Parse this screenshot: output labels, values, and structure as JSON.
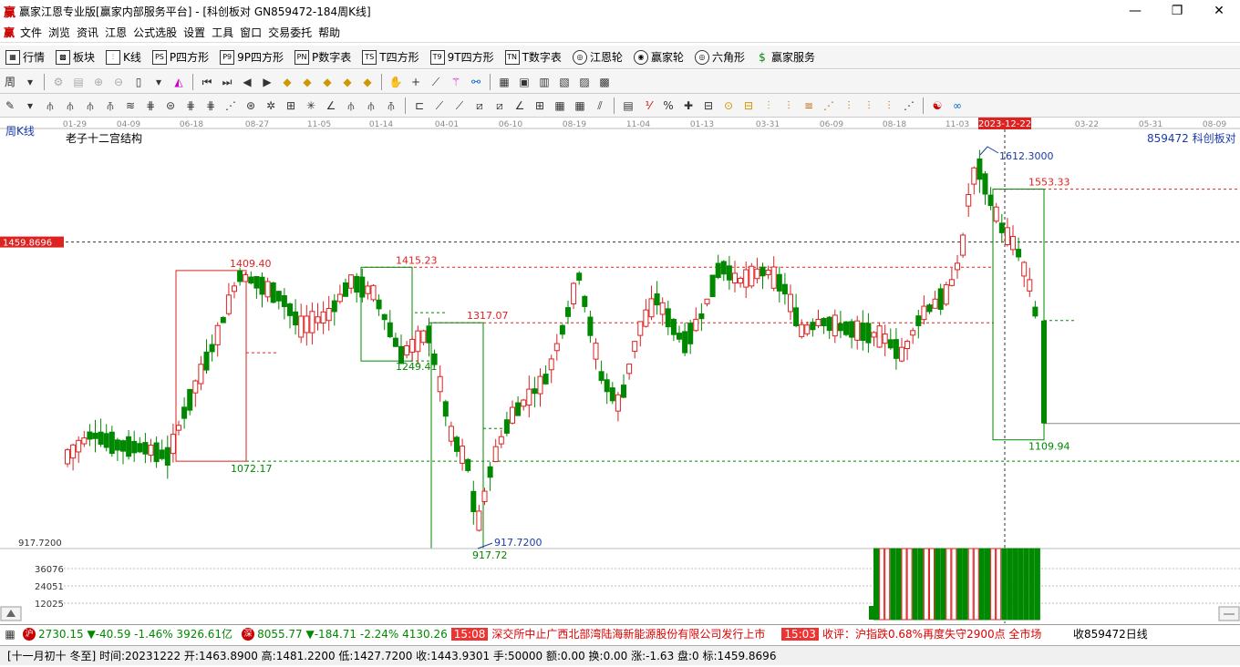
{
  "window": {
    "logo": "赢",
    "title": "赢家江恩专业版[赢家内部服务平台] - [科创板对  GN859472-184周K线]",
    "minimize": "—",
    "maximize": "❐",
    "close": "✕"
  },
  "menu": {
    "logo": "赢",
    "items": [
      "文件",
      "浏览",
      "资讯",
      "江恩",
      "公式选股",
      "设置",
      "工具",
      "窗口",
      "交易委托",
      "帮助"
    ],
    "mdi_min": "_",
    "mdi_restore": "❐",
    "mdi_close": "✕"
  },
  "toolbar1": {
    "items": [
      {
        "icon": "▦",
        "label": "行情"
      },
      {
        "icon": "▩",
        "label": "板块"
      },
      {
        "icon": "⫶",
        "label": "K线"
      },
      {
        "icon": "PS",
        "label": "P四方形"
      },
      {
        "icon": "P9",
        "label": "9P四方形"
      },
      {
        "icon": "PN",
        "label": "P数字表"
      },
      {
        "icon": "TS",
        "label": "T四方形"
      },
      {
        "icon": "T9",
        "label": "9T四方形"
      },
      {
        "icon": "TN",
        "label": "T数字表"
      },
      {
        "icon": "◎",
        "label": "江恩轮"
      },
      {
        "icon": "◉",
        "label": "赢家轮"
      },
      {
        "icon": "◎",
        "label": "六角形"
      },
      {
        "icon": "$",
        "label": "赢家服务"
      }
    ]
  },
  "chart_header": {
    "period": "周K线",
    "indicator": "老子十二宫结构",
    "code_name": "859472  科创板对"
  },
  "time_axis": {
    "labels": [
      "01-29",
      "04-09",
      "06-18",
      "08-27",
      "11-05",
      "01-14",
      "04-01",
      "06-10",
      "08-19",
      "11-04",
      "01-13",
      "03-31",
      "06-09",
      "08-18",
      "11-03",
      "2023-12-22",
      "03-22",
      "05-31",
      "08-09"
    ]
  },
  "price_labels": {
    "crosshair_price": "1459.8696",
    "high_annot": "1612.3000",
    "low_annot": "917.7200",
    "axis_low": "917.7200",
    "levels": [
      {
        "text": "1553.33",
        "color": "#d22"
      },
      {
        "text": "1409.40",
        "color": "#d22"
      },
      {
        "text": "1415.23",
        "color": "#d22"
      },
      {
        "text": "1317.07",
        "color": "#d22"
      },
      {
        "text": "1249.41",
        "color": "#080"
      },
      {
        "text": "1072.17",
        "color": "#080"
      },
      {
        "text": "917.72",
        "color": "#080"
      },
      {
        "text": "1109.94",
        "color": "#080"
      }
    ]
  },
  "volume_axis": [
    "36076",
    "24051",
    "12025"
  ],
  "status1": {
    "idx1_icon": "沪",
    "idx1": "2730.15 ▼-40.59 -1.46% 3926.61亿",
    "idx2_icon": "深",
    "idx2": "8055.77 ▼-184.71 -2.24% 4130.26",
    "news1_time": "15:08",
    "news1": "深交所中止广西北部湾陆海新能源股份有限公司发行上市",
    "news2_time": "15:03",
    "news2": "收评：沪指跌0.68%再度失守2900点 全市场",
    "right": "收859472日线"
  },
  "status2": {
    "text": "[十一月初十 冬至] 时间:20231222 开:1463.8900 高:1481.2200 低:1427.7200 收:1443.9301 手:50000 额:0.00 换:0.00 涨:-1.63 盘:0 标:1459.8696"
  },
  "colors": {
    "up": "#d22",
    "down": "#080",
    "annot_blue": "#1a3aa8"
  }
}
